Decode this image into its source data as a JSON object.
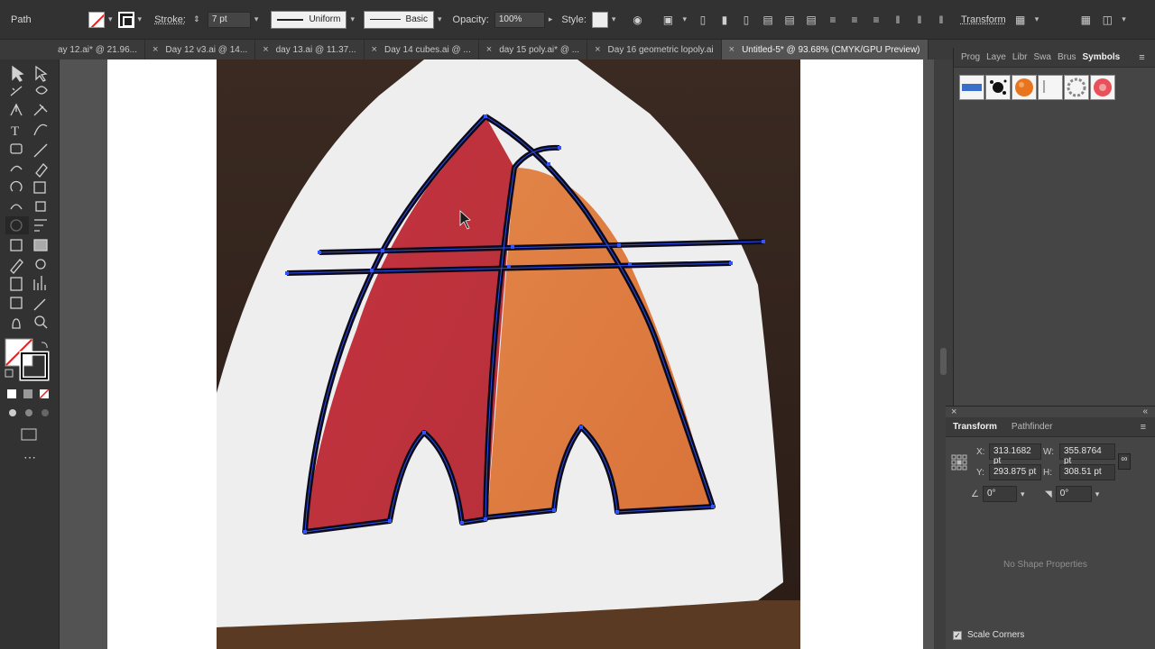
{
  "control_bar": {
    "object_type": "Path",
    "stroke_label": "Stroke:",
    "stroke_weight": "7 pt",
    "profile_label": "Uniform",
    "brush_label": "Basic",
    "opacity_label": "Opacity:",
    "opacity_value": "100%",
    "style_label": "Style:",
    "transform_label": "Transform"
  },
  "tabs": [
    {
      "label": "ay 12.ai* @ 21.96..."
    },
    {
      "label": "Day 12 v3.ai @ 14..."
    },
    {
      "label": "day 13.ai @ 11.37..."
    },
    {
      "label": "Day 14 cubes.ai @ ..."
    },
    {
      "label": "day 15 poly.ai* @ ..."
    },
    {
      "label": "Day 16 geometric lopoly.ai"
    },
    {
      "label": "Untitled-5* @ 93.68% (CMYK/GPU Preview)"
    }
  ],
  "symbols_panel": {
    "tabs": [
      "Prog",
      "Laye",
      "Libr",
      "Swa",
      "Brus",
      "Symbols"
    ],
    "symbols": [
      "blue-banner",
      "ink-splat",
      "orange-ball",
      "cursor-text",
      "gear-ring",
      "flower"
    ]
  },
  "transform_panel": {
    "tabs": [
      "Transform",
      "Pathfinder"
    ],
    "x_label": "X:",
    "x_value": "313.1682 pt",
    "y_label": "Y:",
    "y_value": "293.875 pt",
    "w_label": "W:",
    "w_value": "355.8764 pt",
    "h_label": "H:",
    "h_value": "308.51 pt",
    "rotate_value": "0°",
    "shear_value": "0°",
    "no_shape_text": "No Shape Properties",
    "scale_corners_label": "Scale Corners"
  },
  "colors": {
    "accent_path": "#3355ff",
    "red_fill": "#c8313d",
    "orange_fill": "#e07a3a"
  }
}
